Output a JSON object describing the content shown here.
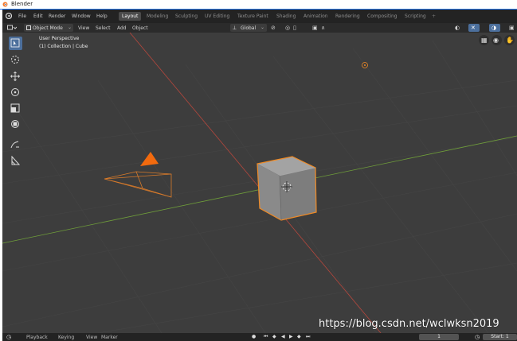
{
  "window": {
    "title": "Blender"
  },
  "topbar": {
    "menus": [
      "File",
      "Edit",
      "Render",
      "Window",
      "Help"
    ],
    "tabs": [
      "Layout",
      "Modeling",
      "Sculpting",
      "UV Editing",
      "Texture Paint",
      "Shading",
      "Animation",
      "Rendering",
      "Compositing",
      "Scripting"
    ],
    "active_tab": "Layout",
    "add_tab": "+"
  },
  "header": {
    "mode": "Object Mode",
    "menus": [
      "View",
      "Select",
      "Add",
      "Object"
    ],
    "orientation": "Global"
  },
  "viewport": {
    "view_name": "User Perspective",
    "collection": "(1) Collection | Cube"
  },
  "timeline": {
    "menus": [
      "Playback",
      "Keying",
      "View",
      "Marker"
    ],
    "current_frame": "1",
    "start_label": "Start:",
    "start_value": "1"
  },
  "watermark": "https://blog.csdn.net/wclwksn2019",
  "colors": {
    "accent_blue": "#4c6f9c",
    "selection_orange": "#f08a24",
    "x_axis": "#b5473d",
    "y_axis": "#6f9e3a",
    "viewport_bg": "#3d3d3d"
  },
  "icons": [
    "blender-logo-icon",
    "cursor-icon",
    "move-icon",
    "rotate-icon",
    "scale-icon",
    "transform-icon",
    "annotate-icon",
    "measure-icon",
    "grid-icon",
    "camera-icon",
    "hand-icon",
    "play-icon"
  ]
}
